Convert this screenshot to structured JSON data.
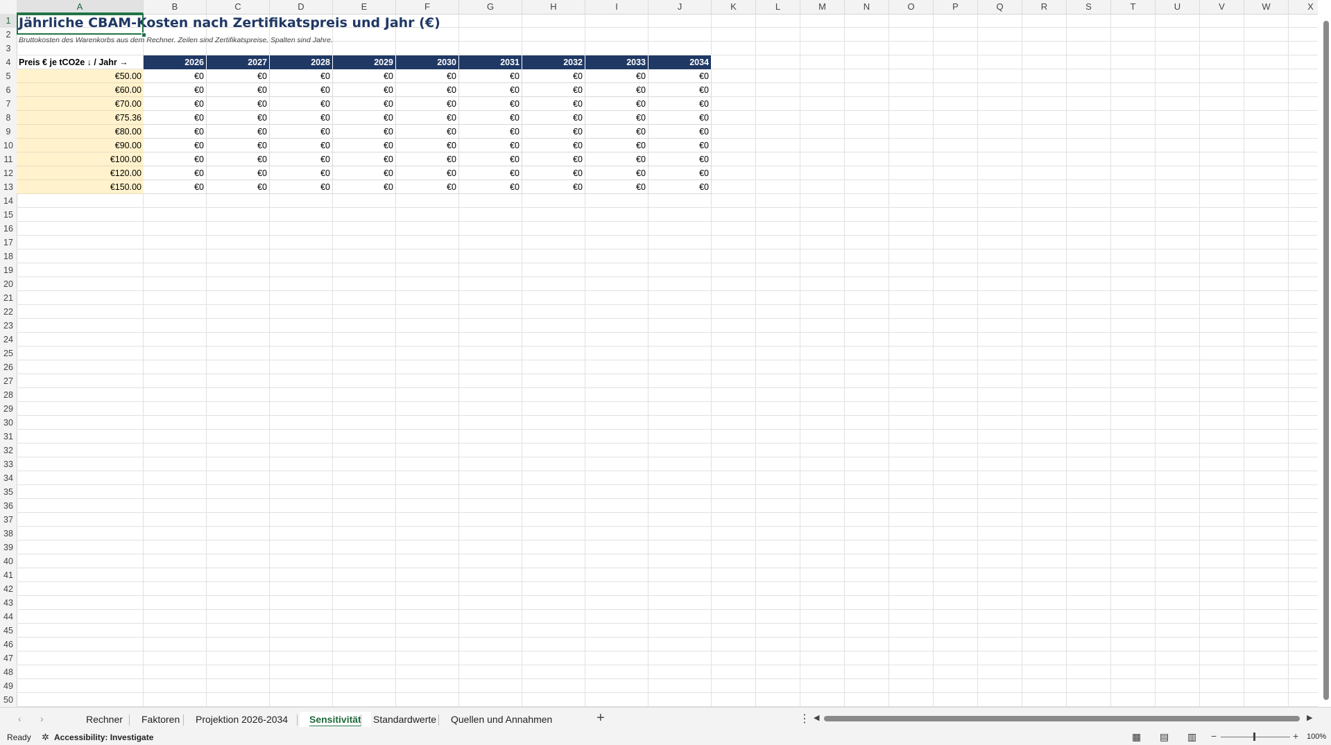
{
  "columns": [
    "A",
    "B",
    "C",
    "D",
    "E",
    "F",
    "G",
    "H",
    "I",
    "J",
    "K",
    "L",
    "M",
    "N",
    "O",
    "P",
    "Q",
    "R",
    "S",
    "T",
    "U",
    "V",
    "W",
    "X"
  ],
  "rows_count": 50,
  "sheet": {
    "title": "Jährliche CBAM-Kosten nach Zertifikatspreis und Jahr (€)",
    "subtitle": "Bruttokosten des Warenkorbs aus dem Rechner. Zeilen sind Zertifikatspreise, Spalten sind Jahre.",
    "corner_label": "Preis € je tCO2e ↓ / Jahr →",
    "years": [
      "2026",
      "2027",
      "2028",
      "2029",
      "2030",
      "2031",
      "2032",
      "2033",
      "2034"
    ],
    "prices": [
      "€50.00",
      "€60.00",
      "€70.00",
      "€75.36",
      "€80.00",
      "€90.00",
      "€100.00",
      "€120.00",
      "€150.00"
    ],
    "cell_value": "€0"
  },
  "tabs": [
    "Rechner",
    "Faktoren",
    "Projektion 2026-2034",
    "Sensitivität",
    "Standardwerte",
    "Quellen und Annahmen"
  ],
  "active_tab": "Sensitivität",
  "add_tab_label": "+",
  "status": {
    "ready": "Ready",
    "accessibility": "Accessibility: Investigate",
    "zoom": "100%"
  },
  "colors": {
    "header_fill": "#1f3864",
    "price_fill": "#fff2cc",
    "accent": "#217346"
  }
}
